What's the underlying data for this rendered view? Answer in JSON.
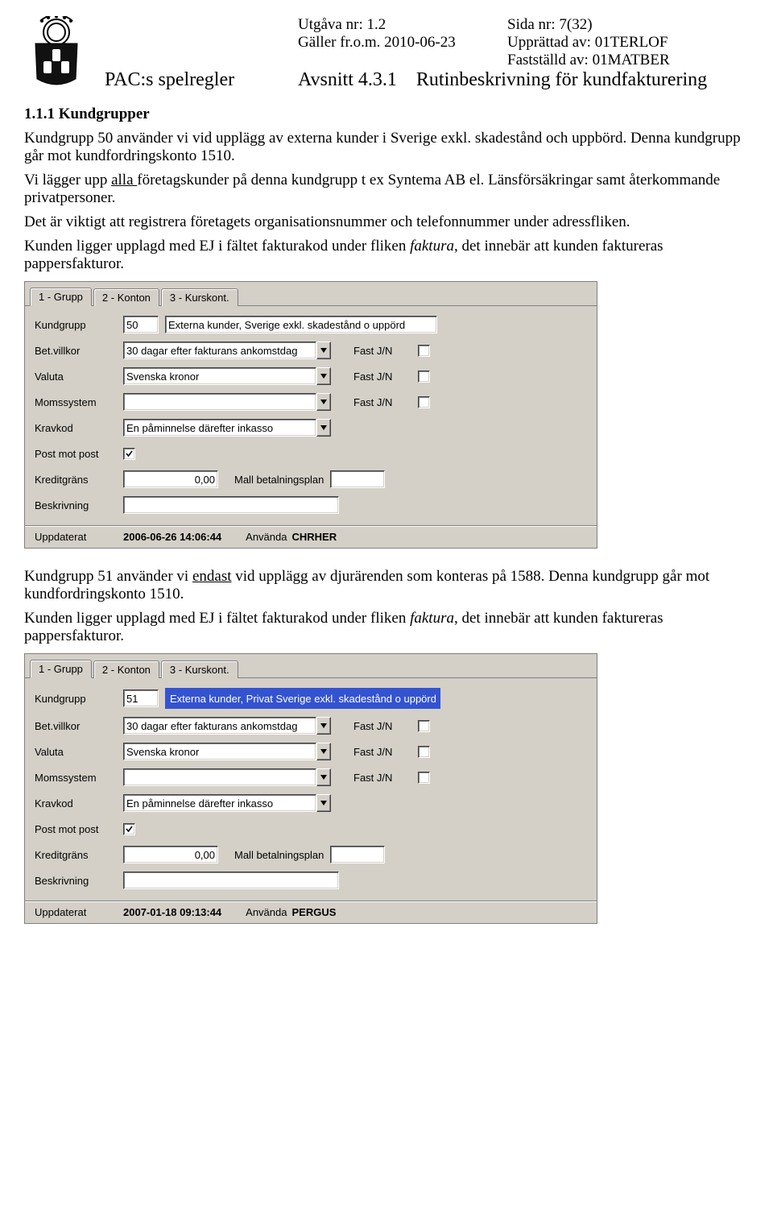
{
  "header": {
    "utg_label": "Utgåva nr:",
    "utg_value": "1.2",
    "sida_label": "Sida nr:",
    "sida_value": "7(32)",
    "galler_label": "Gäller fr.o.m.",
    "galler_value": "2010-06-23",
    "upprattad_label": "Upprättad av:",
    "upprattad_value": "01TERLOF",
    "faststalld_label": "Fastställd av:",
    "faststalld_value": "01MATBER",
    "doc_title": "PAC:s spelregler",
    "avsnitt_label": "Avsnitt",
    "avsnitt_num": "4.3.1",
    "avsnitt_title": "Rutinbeskrivning för kundfakturering"
  },
  "section_heading": "1.1.1 Kundgrupper",
  "para1": {
    "l1a": "Kundgrupp 50 använder vi vid upplägg av externa kunder i Sverige exkl. skadestånd och uppbörd. Denna kundgrupp går mot kundfordringskonto 1510.",
    "l2a": "Vi lägger upp ",
    "l2u": "alla ",
    "l2b": "företagskunder på denna kundgrupp t ex Syntema AB el. Länsförsäkringar samt återkommande privatpersoner.",
    "l3": "Det är viktigt att registrera företagets organisationsnummer och telefonnummer under adressfliken.",
    "l4a": "Kunden ligger upplagd med EJ i fältet fakturakod under fliken ",
    "l4i": "faktura",
    "l4b": ", det innebär att kunden faktureras pappersfakturor."
  },
  "dialog_common": {
    "tab1": "1 - Grupp",
    "tab2": "2 - Konton",
    "tab3": "3 - Kurskont.",
    "lbl_kundgrupp": "Kundgrupp",
    "lbl_betvillkor": "Bet.villkor",
    "lbl_valuta": "Valuta",
    "lbl_momssystem": "Momssystem",
    "lbl_kravkod": "Kravkod",
    "lbl_postmotpost": "Post mot post",
    "lbl_kreditgrans": "Kreditgräns",
    "lbl_beskrivning": "Beskrivning",
    "lbl_fast": "Fast J/N",
    "lbl_mall": "Mall betalningsplan",
    "footer_uppdaterat": "Uppdaterat",
    "footer_anvanda": "Använda"
  },
  "dialog1": {
    "kundgrupp_num": "50",
    "kundgrupp_name": "Externa kunder, Sverige exkl. skadestånd o uppörd",
    "betvillkor": "30 dagar efter fakturans ankomstdag",
    "valuta": "Svenska kronor",
    "momssystem": "",
    "kravkod": "En påminnelse därefter inkasso",
    "postmotpost_checked": true,
    "kreditgrans": "0,00",
    "mall": "",
    "beskrivning": "",
    "uppdaterat": "2006-06-26 14:06:44",
    "anvanda": "CHRHER"
  },
  "para2": {
    "l1a": "Kundgrupp 51 använder vi ",
    "l1u": "endast",
    "l1b": " vid upplägg av djurärenden som konteras på 1588. Denna kundgrupp går mot kundfordringskonto 1510.",
    "l2a": "Kunden ligger upplagd med EJ i fältet fakturakod under fliken ",
    "l2i": "faktura",
    "l2b": ", det innebär att kunden faktureras pappersfakturor."
  },
  "dialog2": {
    "kundgrupp_num": "51",
    "kundgrupp_name": "Externa kunder, Privat Sverige exkl. skadestånd o uppörd",
    "betvillkor": "30 dagar efter fakturans ankomstdag",
    "valuta": "Svenska kronor",
    "momssystem": "",
    "kravkod": "En påminnelse därefter inkasso",
    "postmotpost_checked": true,
    "kreditgrans": "0,00",
    "mall": "",
    "beskrivning": "",
    "uppdaterat": "2007-01-18 09:13:44",
    "anvanda": "PERGUS"
  }
}
